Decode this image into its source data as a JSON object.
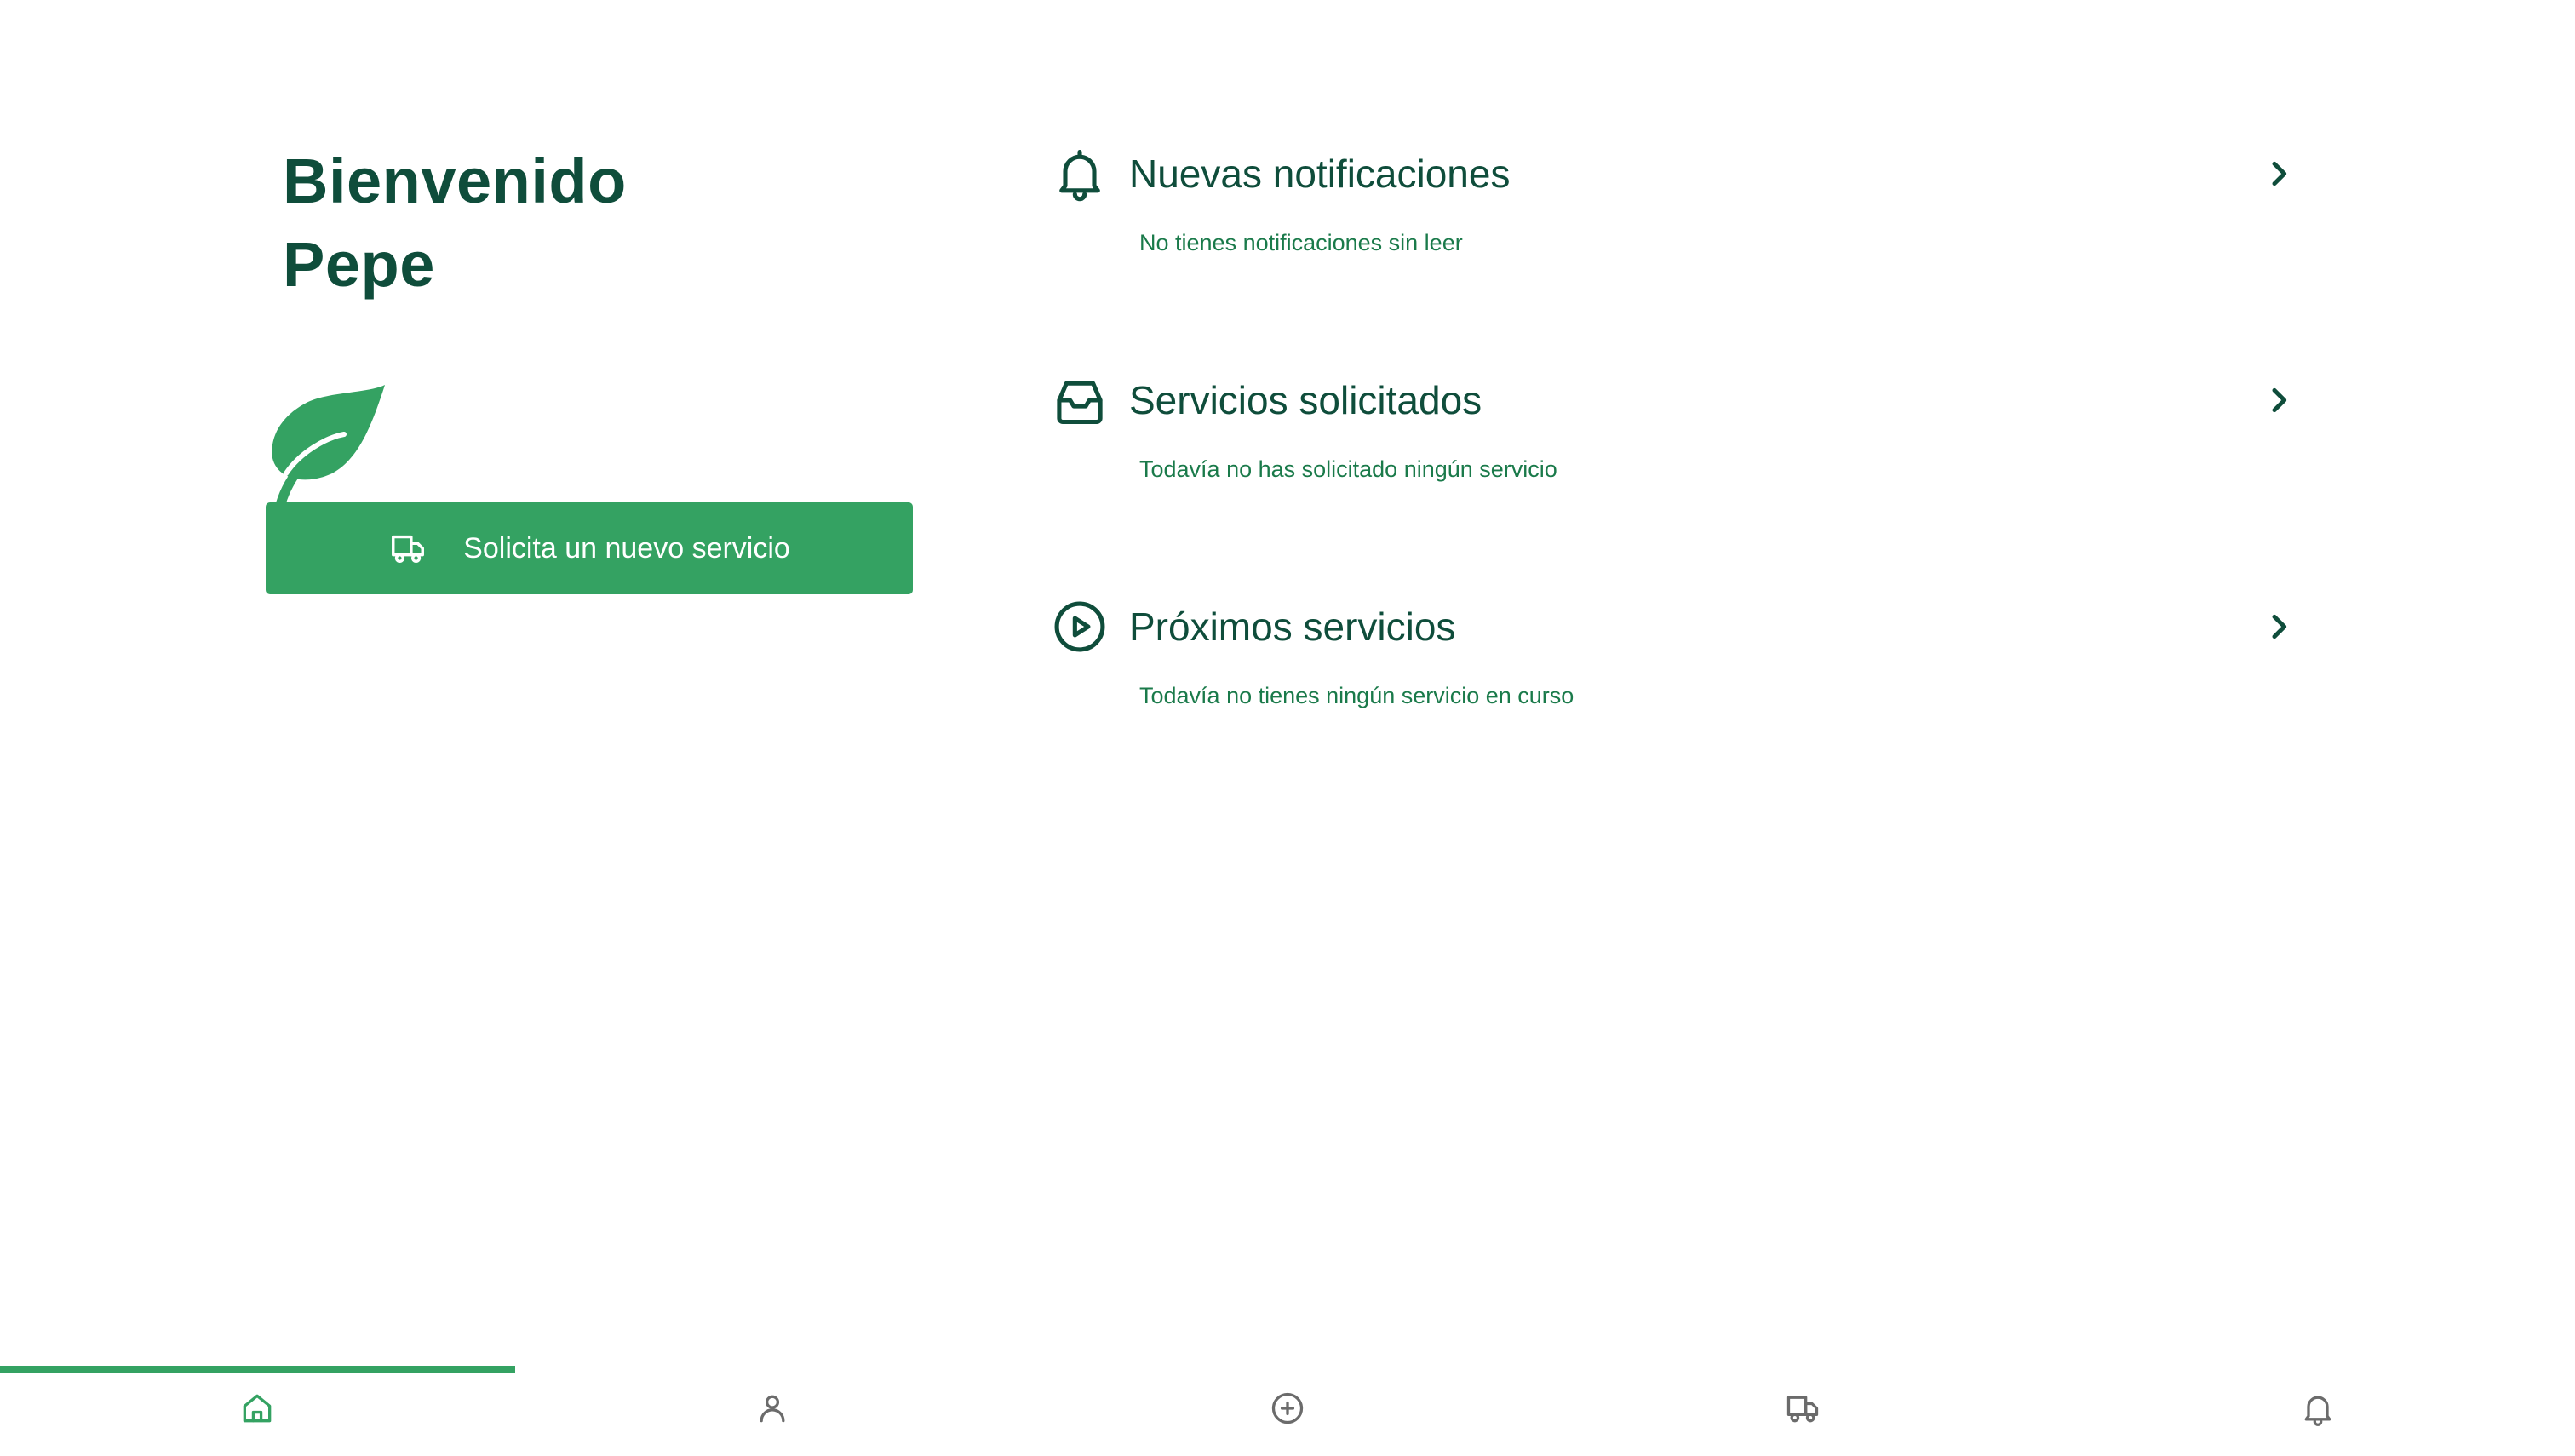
{
  "welcome": {
    "line1": "Bienvenido",
    "line2": "Pepe"
  },
  "new_service_button": {
    "label": "Solicita un nuevo servicio",
    "icon": "truck-icon"
  },
  "sections": [
    {
      "icon": "bell-icon",
      "title": "Nuevas notificaciones",
      "text": "No tienes notificaciones sin leer"
    },
    {
      "icon": "inbox-icon",
      "title": "Servicios solicitados",
      "text": "Todavía no has solicitado ningún servicio"
    },
    {
      "icon": "play-circle-icon",
      "title": "Próximos servicios",
      "text": "Todavía no tienes ningún servicio en curso"
    }
  ],
  "bottom_nav": {
    "items": [
      {
        "icon": "home-icon",
        "active": true
      },
      {
        "icon": "user-icon",
        "active": false
      },
      {
        "icon": "plus-circle-icon",
        "active": false
      },
      {
        "icon": "truck-icon",
        "active": false
      },
      {
        "icon": "bell-icon",
        "active": false
      }
    ]
  },
  "colors": {
    "brand_dark": "#0f4d3b",
    "brand_green": "#34a262",
    "text_green": "#1a7a4a",
    "nav_inactive": "#6b6b6b",
    "background": "#ffffff"
  }
}
